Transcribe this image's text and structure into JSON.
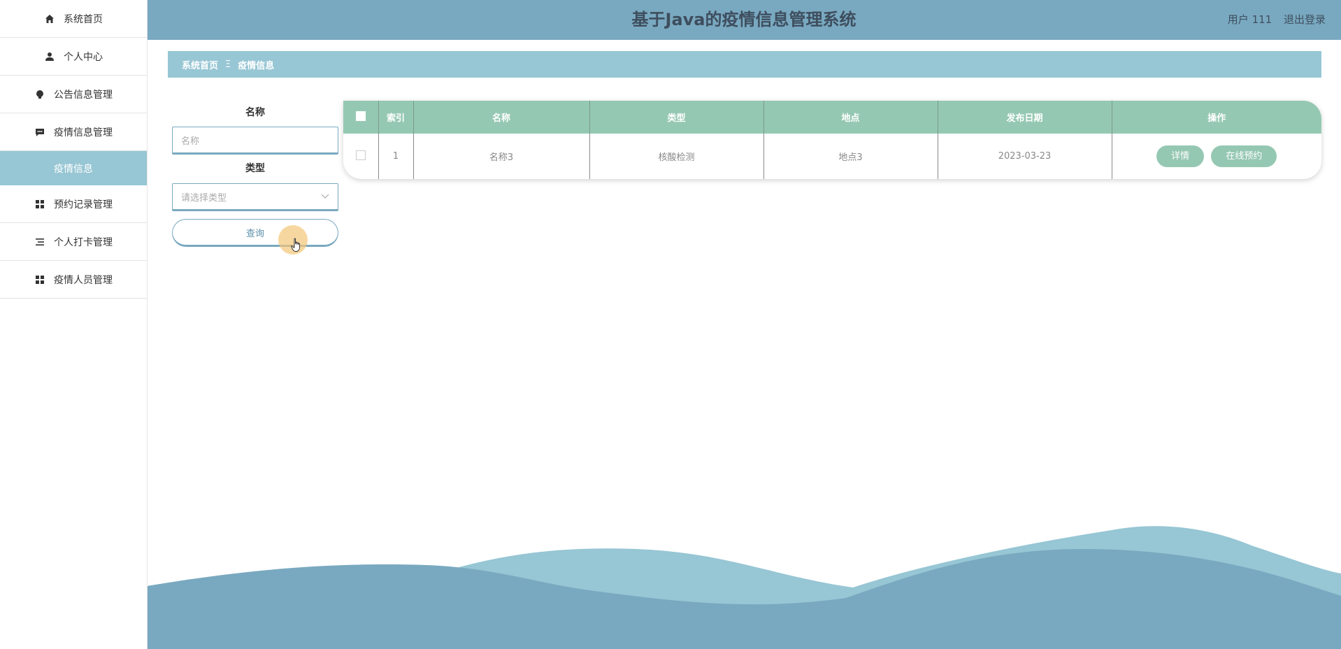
{
  "sidebar": {
    "items": [
      {
        "label": "系统首页",
        "icon": "home-icon"
      },
      {
        "label": "个人中心",
        "icon": "user-icon"
      },
      {
        "label": "公告信息管理",
        "icon": "bulb-icon"
      },
      {
        "label": "疫情信息管理",
        "icon": "chat-icon"
      },
      {
        "label": "疫情信息",
        "sub": true,
        "active": true
      },
      {
        "label": "预约记录管理",
        "icon": "grid-icon"
      },
      {
        "label": "个人打卡管理",
        "icon": "list-icon"
      },
      {
        "label": "疫情人员管理",
        "icon": "grid-icon"
      }
    ]
  },
  "header": {
    "title": "基于Java的疫情信息管理系统",
    "user_label": "用户 111",
    "logout_label": "退出登录"
  },
  "breadcrumb": {
    "home": "系统首页",
    "separator": "Ξ",
    "current": "疫情信息"
  },
  "search": {
    "name_label": "名称",
    "name_placeholder": "名称",
    "type_label": "类型",
    "type_placeholder": "请选择类型",
    "query_button": "查询"
  },
  "table": {
    "headers": [
      "索引",
      "名称",
      "类型",
      "地点",
      "发布日期",
      "操作"
    ],
    "rows": [
      {
        "index": "1",
        "name": "名称3",
        "type": "核酸检测",
        "location": "地点3",
        "date": "2023-03-23"
      }
    ],
    "detail_button": "详情",
    "book_button": "在线预约"
  },
  "colors": {
    "header": "#79a9c0",
    "accent": "#97c6d4",
    "table_header": "#95c8b2"
  }
}
